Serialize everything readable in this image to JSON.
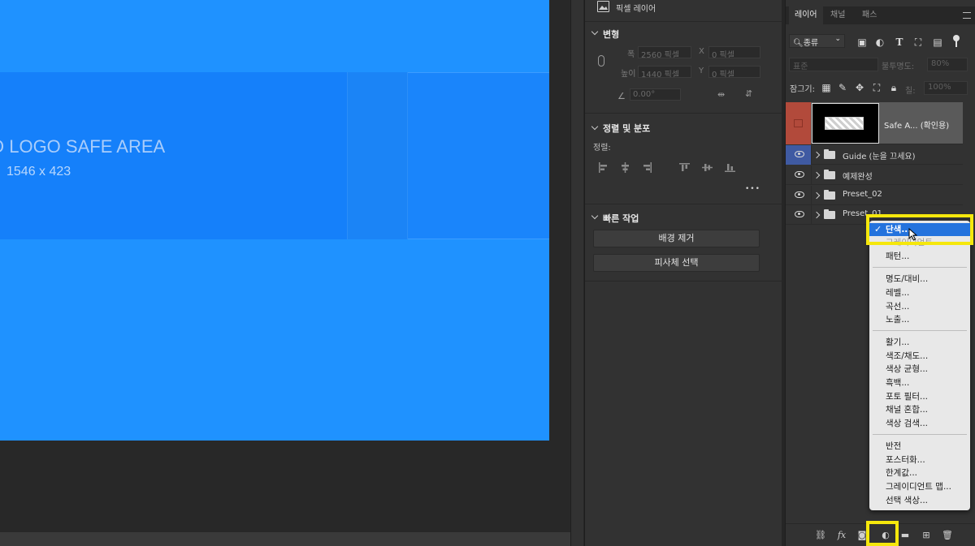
{
  "canvas": {
    "safe_title": "O LOGO SAFE AREA",
    "safe_dims": "1546 x 423"
  },
  "properties": {
    "pixel_layer_label": "픽셀 레이어",
    "transform": {
      "title": "변형",
      "width_label": "폭",
      "width_value": "2560 픽셀",
      "height_label": "높이",
      "height_value": "1440 픽셀",
      "x_label": "X",
      "x_value": "0 픽셀",
      "y_label": "Y",
      "y_value": "0 픽셀",
      "angle_value": "0.00°"
    },
    "align": {
      "title": "정렬 및 분포",
      "sub_label": "정렬:",
      "more": "•••"
    },
    "quick": {
      "title": "빠른 작업",
      "remove_bg": "배경 제거",
      "select_subject": "피사체 선택"
    }
  },
  "layers_panel": {
    "tabs": [
      "레이어",
      "채널",
      "패스"
    ],
    "active_tab": 0,
    "filter_kind": "종류",
    "blend_mode": "표준",
    "opacity_label": "불투명도:",
    "opacity_value": "80%",
    "lock_label": "잠그기:",
    "fill_label": "칠:",
    "fill_value": "100%",
    "layers": [
      {
        "name": "Safe A... (확인용)",
        "type": "artboard",
        "visible": false,
        "color": "#b24a3b"
      },
      {
        "name": "Guide (눈을 끄세요)",
        "type": "group",
        "visible": true
      },
      {
        "name": "예제완성",
        "type": "group",
        "visible": true
      },
      {
        "name": "Preset_02",
        "type": "group",
        "visible": true
      },
      {
        "name": "Preset_01",
        "type": "group",
        "visible": true
      }
    ]
  },
  "adjust_menu": {
    "groups": [
      [
        {
          "label": "단색...",
          "selected": true,
          "checked": true
        },
        {
          "label": "그레이디언트...",
          "selected": false
        },
        {
          "label": "패턴...",
          "selected": false
        }
      ],
      [
        {
          "label": "명도/대비..."
        },
        {
          "label": "레벨..."
        },
        {
          "label": "곡선..."
        },
        {
          "label": "노출..."
        }
      ],
      [
        {
          "label": "활기..."
        },
        {
          "label": "색조/채도..."
        },
        {
          "label": "색상 균형..."
        },
        {
          "label": "흑백..."
        },
        {
          "label": "포토 필터..."
        },
        {
          "label": "채널 혼합..."
        },
        {
          "label": "색상 검색..."
        }
      ],
      [
        {
          "label": "반전"
        },
        {
          "label": "포스터화..."
        },
        {
          "label": "한계값..."
        },
        {
          "label": "그레이디언트 맵..."
        },
        {
          "label": "선택 색상..."
        }
      ]
    ]
  },
  "colors": {
    "highlight": "#f5e70c",
    "selected_item": "#2473dd",
    "canvas_blue": "#1f92ff"
  }
}
